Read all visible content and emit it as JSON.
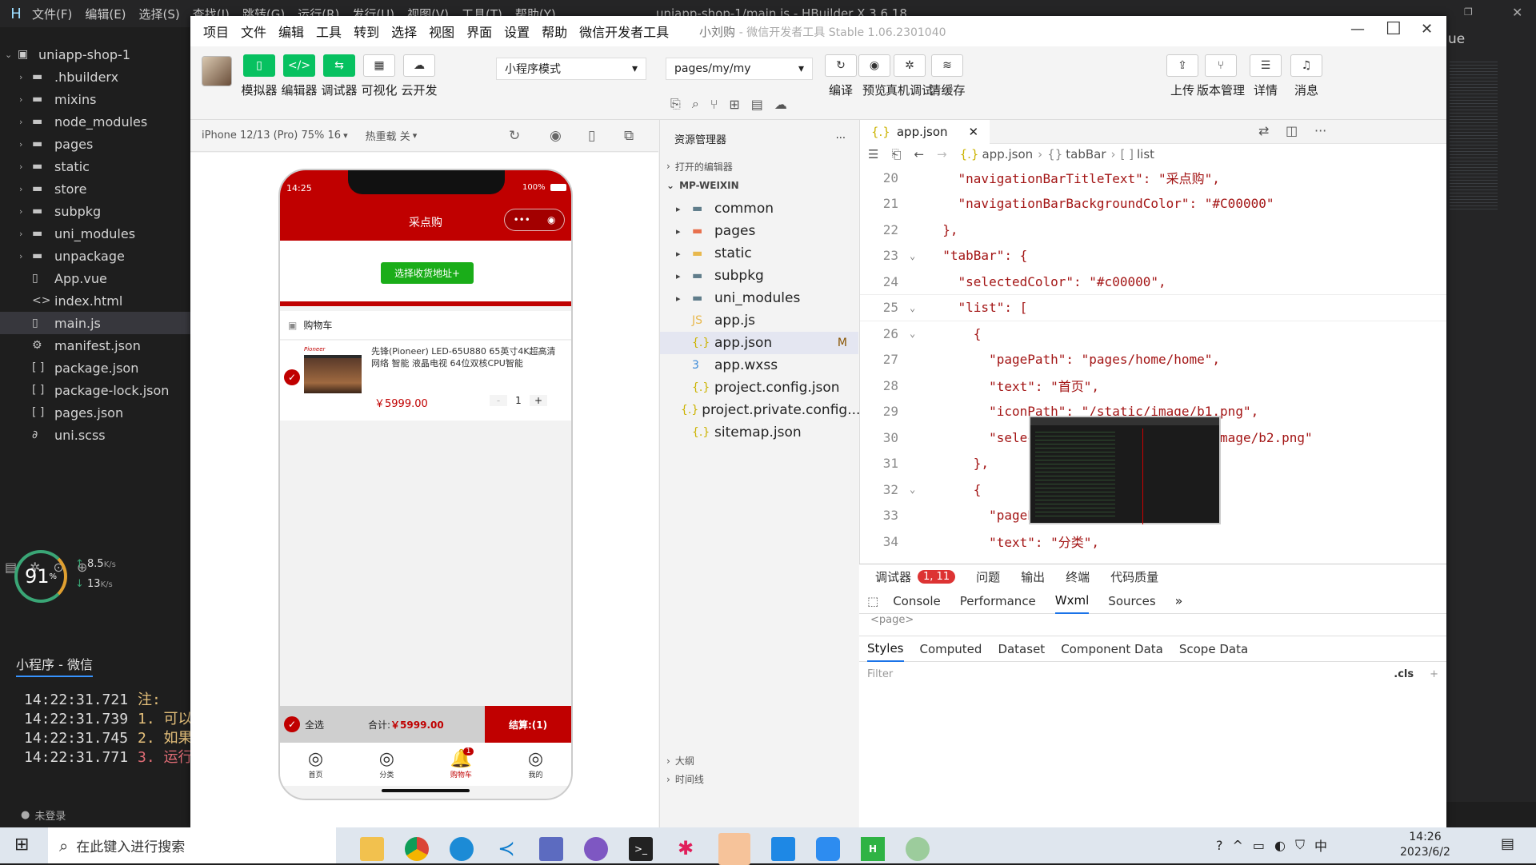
{
  "hbuilder": {
    "menu": [
      "文件(F)",
      "编辑(E)",
      "选择(S)",
      "查找(I)",
      "跳转(G)",
      "运行(R)",
      "发行(U)",
      "视图(V)",
      "工具(T)",
      "帮助(Y)"
    ],
    "title": "uniapp-shop-1/main.js - HBuilder X 3.6.18",
    "project": "uniapp-shop-1",
    "tree": [
      {
        "label": ".hbuilderx",
        "type": "folder"
      },
      {
        "label": "mixins",
        "type": "folder"
      },
      {
        "label": "node_modules",
        "type": "folder"
      },
      {
        "label": "pages",
        "type": "folder"
      },
      {
        "label": "static",
        "type": "folder"
      },
      {
        "label": "store",
        "type": "folder"
      },
      {
        "label": "subpkg",
        "type": "folder"
      },
      {
        "label": "uni_modules",
        "type": "folder"
      },
      {
        "label": "unpackage",
        "type": "folder"
      },
      {
        "label": "App.vue",
        "type": "file",
        "icon": "▯"
      },
      {
        "label": "index.html",
        "type": "file",
        "icon": "<>"
      },
      {
        "label": "main.js",
        "type": "file",
        "icon": "▯"
      },
      {
        "label": "manifest.json",
        "type": "file",
        "icon": "⚙"
      },
      {
        "label": "package.json",
        "type": "file",
        "icon": "[ ]"
      },
      {
        "label": "package-lock.json",
        "type": "file",
        "icon": "[ ]"
      },
      {
        "label": "pages.json",
        "type": "file",
        "icon": "[ ]"
      },
      {
        "label": "uni.scss",
        "type": "file",
        "icon": "∂"
      }
    ],
    "speed": {
      "pct": "91",
      "unit": "%",
      "up": "8.5",
      "down": "13",
      "rate_unit": "K/s"
    },
    "console_tab": "小程序 - 微信",
    "console_lines": [
      {
        "time": "14:22:31.721",
        "text": "注:",
        "color": "#e5c07b"
      },
      {
        "time": "14:22:31.739",
        "text": "1. 可以",
        "color": "#e5c07b"
      },
      {
        "time": "14:22:31.745",
        "text": "2. 如果",
        "color": "#e5c07b"
      },
      {
        "time": "14:22:31.771",
        "text": "3. 运行",
        "color": "#e06c75"
      }
    ],
    "status_login": "未登录",
    "right_partial": "ue"
  },
  "wx": {
    "menu": [
      "项目",
      "文件",
      "编辑",
      "工具",
      "转到",
      "选择",
      "视图",
      "界面",
      "设置",
      "帮助",
      "微信开发者工具"
    ],
    "title": "小刘购",
    "title_sub": "- 微信开发者工具 Stable 1.06.2301040",
    "tools_left": [
      "模拟器",
      "编辑器",
      "调试器",
      "可视化",
      "云开发"
    ],
    "mode": "小程序模式",
    "page_path": "pages/my/my",
    "tools_mid": [
      "编译",
      "预览",
      "真机调试",
      "清缓存"
    ],
    "tools_right": [
      "上传",
      "版本管理",
      "详情",
      "消息"
    ],
    "device": "iPhone 12/13 (Pro) 75% 16",
    "reload": "热重载 关",
    "explorer_title": "资源管理器",
    "open_editors": "打开的编辑器",
    "project_root": "MP-WEIXIN",
    "files": [
      {
        "label": "common",
        "icon": "folder",
        "color": "#607d8b"
      },
      {
        "label": "pages",
        "icon": "folder",
        "color": "#e8704d"
      },
      {
        "label": "static",
        "icon": "folder",
        "color": "#e8b84d"
      },
      {
        "label": "subpkg",
        "icon": "folder",
        "color": "#607d8b"
      },
      {
        "label": "uni_modules",
        "icon": "folder",
        "color": "#607d8b"
      },
      {
        "label": "app.js",
        "icon": "js",
        "color": "#e8b84d"
      },
      {
        "label": "app.json",
        "icon": "json",
        "color": "#cbb300",
        "status": "M"
      },
      {
        "label": "app.wxss",
        "icon": "css",
        "color": "#3c8ad8"
      },
      {
        "label": "project.config.json",
        "icon": "json",
        "color": "#cbb300"
      },
      {
        "label": "project.private.config...",
        "icon": "json",
        "color": "#cbb300"
      },
      {
        "label": "sitemap.json",
        "icon": "json",
        "color": "#cbb300"
      }
    ],
    "outline": "大纲",
    "timeline": "时间线",
    "tab": "app.json",
    "breadcrumb": [
      "app.json",
      "tabBar",
      "list"
    ],
    "code": [
      {
        "n": "20",
        "t": "    \"navigationBarTitleText\": \"采点购\","
      },
      {
        "n": "21",
        "t": "    \"navigationBarBackgroundColor\": \"#C00000\""
      },
      {
        "n": "22",
        "t": "  },"
      },
      {
        "n": "23",
        "t": "  \"tabBar\": {"
      },
      {
        "n": "24",
        "t": "    \"selectedColor\": \"#c00000\","
      },
      {
        "n": "25",
        "t": "    \"list\": ["
      },
      {
        "n": "26",
        "t": "      {"
      },
      {
        "n": "27",
        "t": "        \"pagePath\": \"pages/home/home\","
      },
      {
        "n": "28",
        "t": "        \"text\": \"首页\","
      },
      {
        "n": "29",
        "t": "        \"iconPath\": \"/static/image/b1.png\","
      },
      {
        "n": "30",
        "t": "        \"selectedIconPath\": \"/static/image/b2.png\""
      },
      {
        "n": "31",
        "t": "      },"
      },
      {
        "n": "32",
        "t": "      {"
      },
      {
        "n": "33",
        "t": "        \"pagePath\": \"pages/cate/cate\","
      },
      {
        "n": "34",
        "t": "        \"text\": \"分类\","
      }
    ],
    "debug_tabs": [
      "调试器",
      "问题",
      "输出",
      "终端",
      "代码质量"
    ],
    "debug_badge": "1, 11",
    "dev_tabs": [
      "Console",
      "Performance",
      "Wxml",
      "Sources"
    ],
    "wxml_snip": "<page>",
    "style_tabs": [
      "Styles",
      "Computed",
      "Dataset",
      "Component Data",
      "Scope Data"
    ],
    "filter_ph": "Filter",
    "cls": ".cls"
  },
  "phone": {
    "time": "14:25",
    "battery": "100%",
    "nav_title": "采点购",
    "address_btn": "选择收货地址+",
    "cart_title": "购物车",
    "product_brand": "Pioneer",
    "product_name": "先锋(Pioneer) LED-65U880 65英寸4K超高清 网络 智能 液晶电视 64位双核CPU智能",
    "price": "￥5999.00",
    "qty": "1",
    "select_all": "全选",
    "total_label": "合计:",
    "total": "￥5999.00",
    "checkout": "结算:(1)",
    "tabs": [
      "首页",
      "分类",
      "购物车",
      "我的"
    ],
    "cart_badge": "1"
  },
  "taskbar": {
    "search": "在此键入进行搜索",
    "time": "14:26",
    "date": "2023/6/2",
    "ime": "中"
  }
}
